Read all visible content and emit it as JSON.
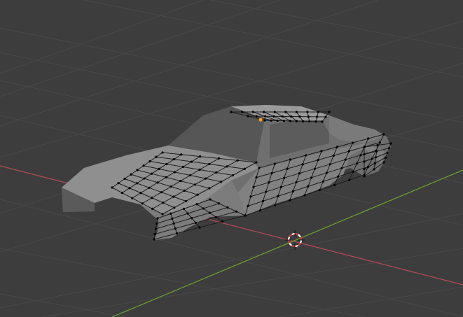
{
  "viewport": {
    "background": "#3d3d3d",
    "grid_color": "#4a4a4a",
    "x_axis_color": "#b24a55",
    "y_axis_color": "#6a9c2e",
    "mesh_fill": "#8d8d8d",
    "mesh_shadow": "#5e5e5e",
    "wire_color": "#1a1a1a",
    "vertex_color": "#000000",
    "active_vertex_color": "#ff9a1f",
    "cursor_colors": [
      "#d8383b",
      "#ffffff"
    ]
  },
  "icons": {
    "cursor": "3d-cursor-icon",
    "active_vertex": "active-vertex-icon"
  }
}
